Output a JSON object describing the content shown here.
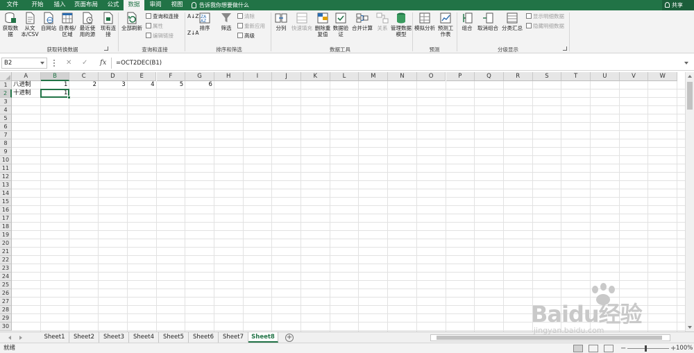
{
  "tabs": [
    "文件",
    "开始",
    "插入",
    "页面布局",
    "公式",
    "数据",
    "审阅",
    "视图"
  ],
  "active_tab": "数据",
  "tell_me": "告诉我你想要做什么",
  "share": "共享",
  "ribbon": {
    "get_data": "获取数据",
    "from_csv": "从文本/CSV",
    "from_web": "自网站",
    "from_table": "自表格/区域",
    "recent_sources": "最近使用的源",
    "existing_conn": "现有连接",
    "group_get": "获取转换数据",
    "refresh_all": "全部刷新",
    "queries_conn": "查询和连接",
    "properties": "属性",
    "edit_links": "编辑链接",
    "group_queries": "查询和连接",
    "sort": "排序",
    "filter": "筛选",
    "clear": "清除",
    "reapply": "重新应用",
    "advanced": "高级",
    "group_sort": "排序和筛选",
    "text_to_cols": "分列",
    "flash_fill": "快速填充",
    "remove_dup": "删除重复值",
    "data_valid": "数据验证",
    "consolidate": "合并计算",
    "relations": "关系",
    "data_model": "管理数据模型",
    "group_tools": "数据工具",
    "whatif": "模拟分析",
    "forecast": "预测工作表",
    "group_forecast": "预测",
    "group_btn": "组合",
    "ungroup": "取消组合",
    "subtotal": "分类汇总",
    "show_detail": "显示明细数据",
    "hide_detail": "隐藏明细数据",
    "group_outline": "分级显示"
  },
  "formula_bar": {
    "name_box": "B2",
    "cancel": "✕",
    "enter": "✓",
    "fx": "fx",
    "formula": "=OCT2DEC(B1)"
  },
  "columns": [
    "A",
    "B",
    "C",
    "D",
    "E",
    "F",
    "G",
    "H",
    "I",
    "J",
    "K",
    "L",
    "M",
    "N",
    "O",
    "P",
    "Q",
    "R",
    "S",
    "T",
    "U",
    "V",
    "W"
  ],
  "rows": [
    "1",
    "2",
    "3",
    "4",
    "5",
    "6",
    "7",
    "8",
    "9",
    "10",
    "11",
    "12",
    "13",
    "14",
    "15",
    "16",
    "17",
    "18",
    "19",
    "20",
    "21",
    "22",
    "23",
    "24",
    "25",
    "26",
    "27",
    "28",
    "29",
    "30"
  ],
  "cells": {
    "A1": "八进制",
    "A2": "十进制",
    "B1": "1",
    "C1": "2",
    "D1": "3",
    "E1": "4",
    "F1": "5",
    "G1": "6",
    "B2": "1"
  },
  "sheets": [
    "Sheet1",
    "Sheet2",
    "Sheet3",
    "Sheet4",
    "Sheet5",
    "Sheet6",
    "Sheet7",
    "Sheet8"
  ],
  "active_sheet": "Sheet8",
  "status": "就绪",
  "zoom": "100%",
  "watermark": {
    "word": "Baidu经验",
    "url": "jingyan.baidu.com"
  },
  "colors": {
    "accent": "#217346"
  }
}
